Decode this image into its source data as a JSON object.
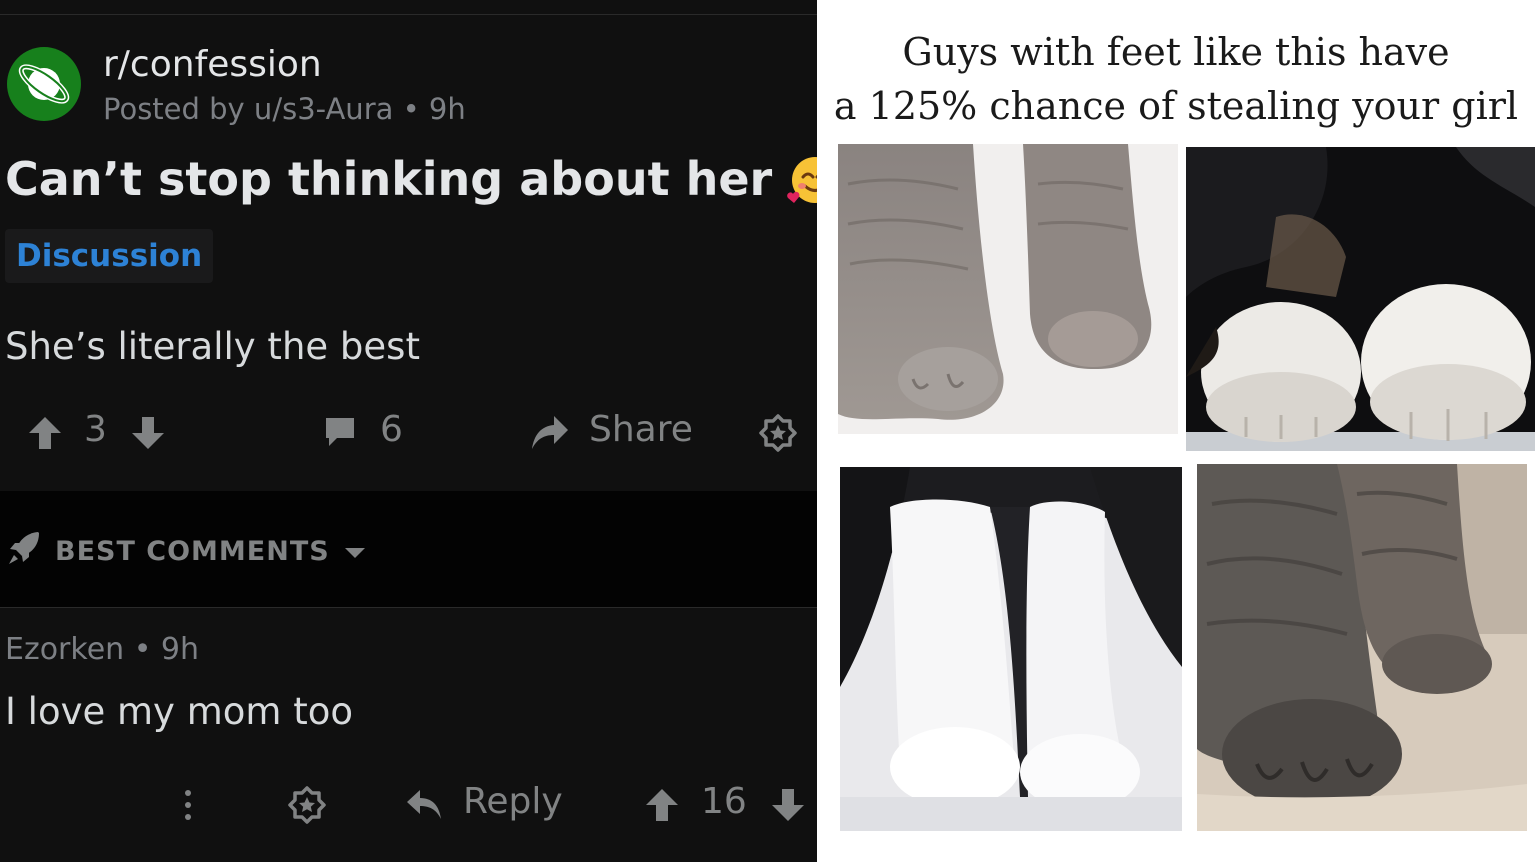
{
  "post": {
    "subreddit": "r/confession",
    "posted_by": "Posted by u/s3-Aura • 9h",
    "title": "Can’t stop thinking about her",
    "title_emoji": "smiling-face-with-hearts-icon",
    "flair": "Discussion",
    "body": "She’s literally the best",
    "votes": "3",
    "comments": "6",
    "share_label": "Share"
  },
  "sort": {
    "label": "BEST COMMENTS"
  },
  "comment": {
    "meta": "Ezorken • 9h",
    "body": "I love my mom too",
    "reply_label": "Reply",
    "votes": "16"
  },
  "meme": {
    "caption_line1": "Guys with feet like this have",
    "caption_line2": "a 125% chance of stealing your girl",
    "images": [
      "grey-cat-paws",
      "white-cat-paws-on-dark",
      "black-and-white-cat-legs",
      "tabby-cat-paw-closeup"
    ]
  },
  "colors": {
    "background": "#101010",
    "flair": "#2d82d6",
    "subreddit_icon": "#17801c",
    "muted": "#818384"
  }
}
